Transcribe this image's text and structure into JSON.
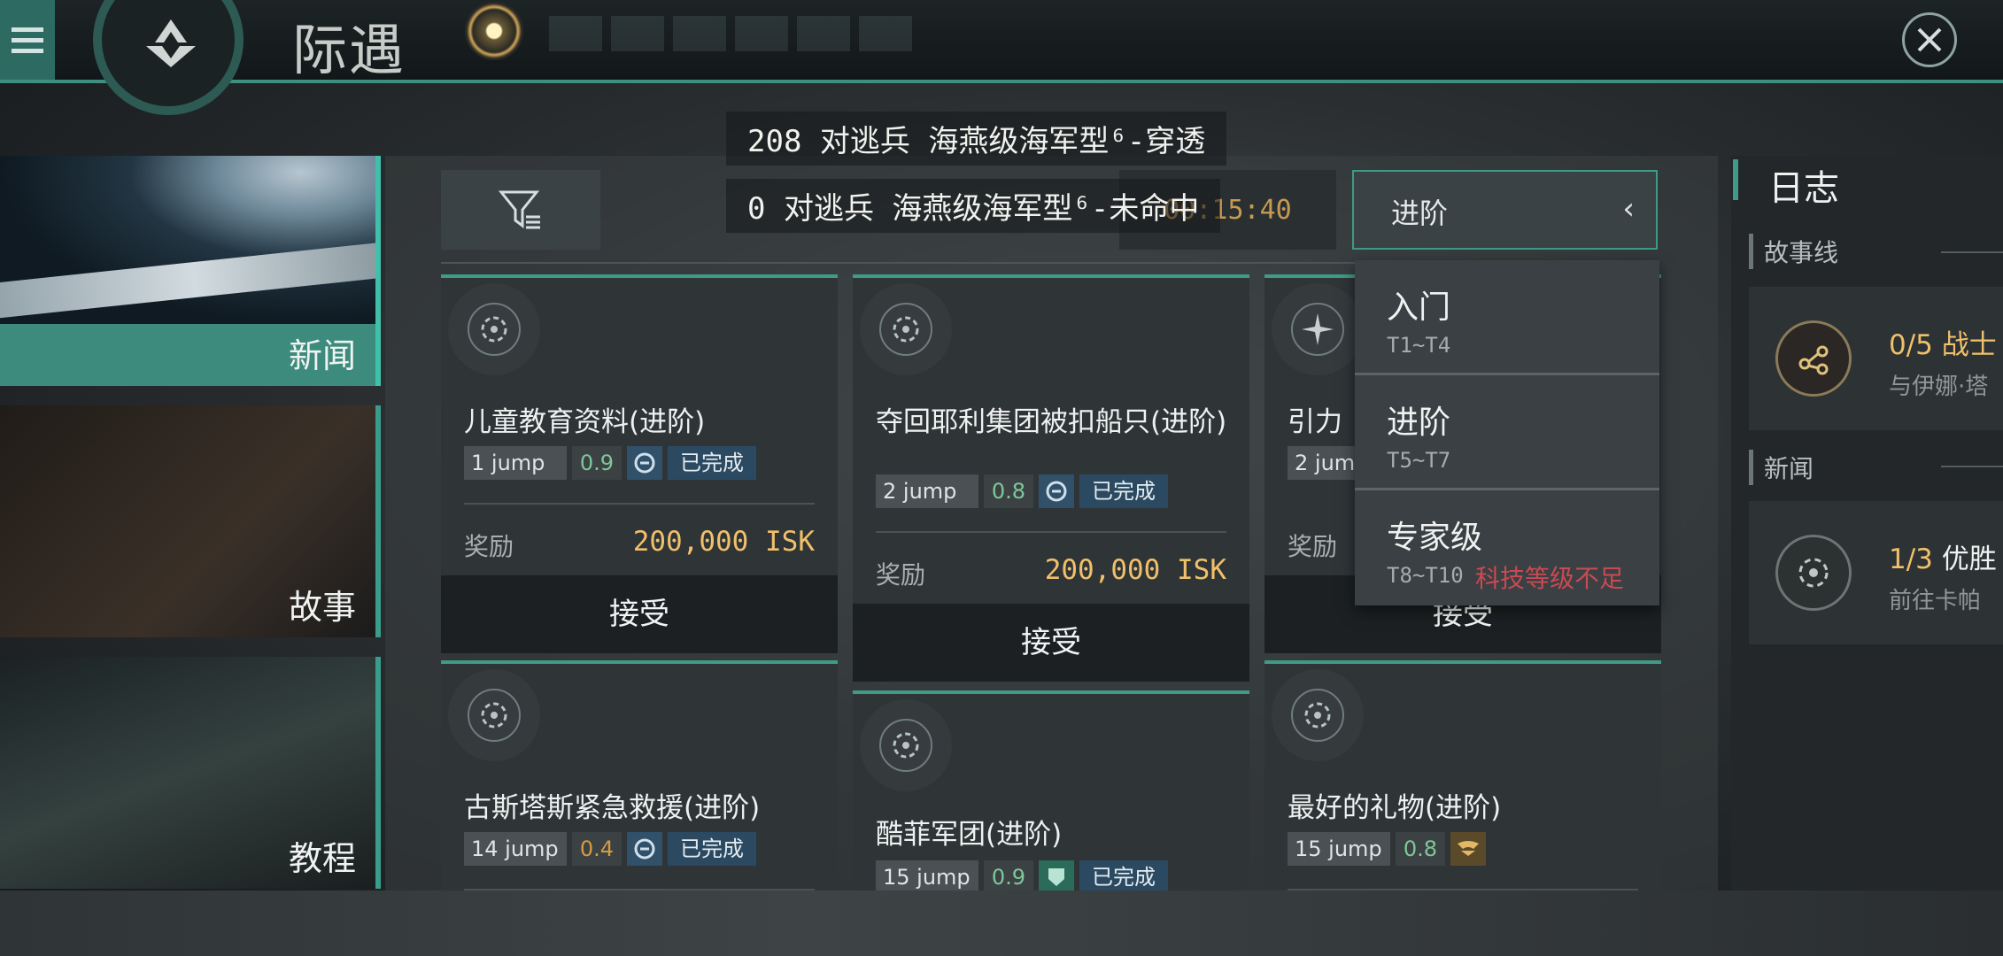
{
  "header": {
    "title": "际遇",
    "close_label": "close"
  },
  "toasts": [
    "208 对逃兵 海燕级海军型⁶-穿透",
    "0 对逃兵 海燕级海军型⁶-未命中"
  ],
  "nav": {
    "items": [
      {
        "label": "新闻"
      },
      {
        "label": "故事"
      },
      {
        "label": "教程"
      }
    ]
  },
  "toolbar": {
    "timer": "00:15:40",
    "dropdown_selected": "进阶",
    "dropdown_chevron": "‹"
  },
  "dropdown": {
    "options": [
      {
        "name": "入门",
        "tiers": "T1~T4",
        "warning": ""
      },
      {
        "name": "进阶",
        "tiers": "T5~T7",
        "warning": ""
      },
      {
        "name": "专家级",
        "tiers": "T8~T10",
        "warning": "科技等级不足"
      }
    ]
  },
  "cards": [
    {
      "title": "儿童教育资料(进阶)",
      "jump": "1 jump",
      "sec": "0.9",
      "status": "已完成",
      "reward_label": "奖励",
      "reward": "200,000 ISK",
      "accept": "接受"
    },
    {
      "title": "夺回耶利集团被扣船只(进阶)",
      "jump": "2 jump",
      "sec": "0.8",
      "status": "已完成",
      "reward_label": "奖励",
      "reward": "200,000 ISK",
      "accept": "接受"
    },
    {
      "title": "引力",
      "jump": "2 jump",
      "sec": "",
      "status": "",
      "reward_label": "奖励",
      "reward": "",
      "accept": "接受"
    },
    {
      "title": "古斯塔斯紧急救援(进阶)",
      "jump": "14 jump",
      "sec": "0.4",
      "status": "已完成"
    },
    {
      "title": "酷菲军团(进阶)",
      "jump": "15 jump",
      "sec": "0.9",
      "status": "已完成"
    },
    {
      "title": "最好的礼物(进阶)",
      "jump": "15 jump",
      "sec": "0.8",
      "status": ""
    }
  ],
  "log": {
    "title": "日志",
    "sections": [
      {
        "label": "故事线",
        "progress": "0/5",
        "name": "战士",
        "sub": "与伊娜·塔"
      },
      {
        "label": "新闻",
        "progress": "1/3",
        "name": "优胜",
        "sub": "前往卡帕"
      }
    ]
  },
  "colors": {
    "accent": "#3f9a88",
    "reward": "#f0c06a",
    "warning": "#c94a52",
    "timer": "#c79a52"
  },
  "icons": [
    "menu-icon",
    "logo-icon",
    "close-icon",
    "filter-icon",
    "agent-emblem-icon",
    "star-emblem-icon",
    "route-icon",
    "target-icon"
  ]
}
